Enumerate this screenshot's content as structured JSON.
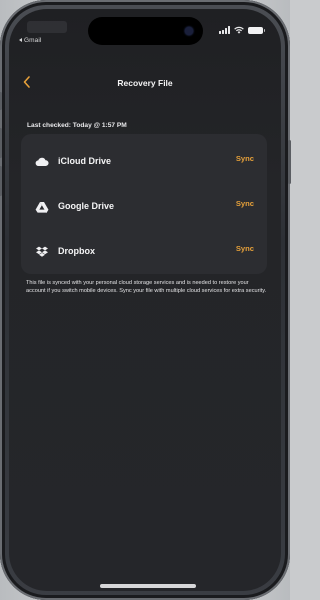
{
  "status_bar": {
    "back_app_label": "Gmail"
  },
  "nav": {
    "title": "Recovery File"
  },
  "last_checked": "Last checked: Today @ 1:57 PM",
  "services": [
    {
      "name": "iCloud Drive",
      "icon": "cloud-icon",
      "action": "Sync"
    },
    {
      "name": "Google Drive",
      "icon": "google-drive-icon",
      "action": "Sync"
    },
    {
      "name": "Dropbox",
      "icon": "dropbox-icon",
      "action": "Sync"
    }
  ],
  "description": "This file is synced with your personal cloud storage services and is needed to restore your account if you switch mobile devices. Sync your file with multiple cloud services for extra security.",
  "colors": {
    "accent": "#e7a13a",
    "background": "#242528",
    "card": "#2c2d31",
    "text": "#f5f5f6"
  }
}
